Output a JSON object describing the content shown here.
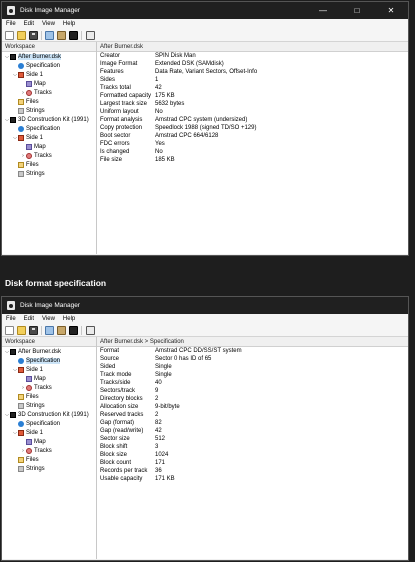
{
  "window1": {
    "title": "Disk Image Manager",
    "menu": [
      "File",
      "Edit",
      "View",
      "Help"
    ],
    "workspace_label": "Workspace",
    "breadcrumb": "After Burner.dsk",
    "tree": [
      {
        "caret": "⌵",
        "icon": "disk",
        "label": "After Burner.dsk",
        "indent": 0,
        "selected": true
      },
      {
        "caret": "",
        "icon": "spec",
        "label": "Specification",
        "indent": 1
      },
      {
        "caret": "⌵",
        "icon": "side",
        "label": "Side 1",
        "indent": 1
      },
      {
        "caret": "",
        "icon": "map",
        "label": "Map",
        "indent": 2
      },
      {
        "caret": "›",
        "icon": "tracks",
        "label": "Tracks",
        "indent": 2
      },
      {
        "caret": "",
        "icon": "files",
        "label": "Files",
        "indent": 1
      },
      {
        "caret": "",
        "icon": "strings",
        "label": "Strings",
        "indent": 1
      },
      {
        "caret": "⌵",
        "icon": "disk",
        "label": "3D Construction Kit (1991)",
        "indent": 0
      },
      {
        "caret": "",
        "icon": "spec",
        "label": "Specification",
        "indent": 1
      },
      {
        "caret": "⌵",
        "icon": "side",
        "label": "Side 1",
        "indent": 1
      },
      {
        "caret": "",
        "icon": "map",
        "label": "Map",
        "indent": 2
      },
      {
        "caret": "›",
        "icon": "tracks",
        "label": "Tracks",
        "indent": 2
      },
      {
        "caret": "",
        "icon": "files",
        "label": "Files",
        "indent": 1
      },
      {
        "caret": "",
        "icon": "strings",
        "label": "Strings",
        "indent": 1
      }
    ],
    "properties": [
      [
        "Creator",
        "SPIN Disk Man"
      ],
      [
        "Image Format",
        "Extended DSK (SAMdisk)"
      ],
      [
        "Features",
        "Data Rate, Variant Sectors, Offset-Info"
      ],
      [
        "Sides",
        "1"
      ],
      [
        "Tracks total",
        "42"
      ],
      [
        "Formatted capacity",
        "175 KB"
      ],
      [
        "Largest track size",
        "5632 bytes"
      ],
      [
        "Uniform layout",
        "No"
      ],
      [
        "Format analysis",
        "Amstrad CPC system (undersized)"
      ],
      [
        "Copy protection",
        "Speedlock 1988 (signed TD/SO +129)"
      ],
      [
        "Boot sector",
        "Amstrad CPC 664/6128"
      ],
      [
        "FDC errors",
        "Yes"
      ],
      [
        "Is changed",
        "No"
      ],
      [
        "File size",
        "185 KB"
      ]
    ]
  },
  "section_heading": "Disk format specification",
  "window2": {
    "title": "Disk Image Manager",
    "menu": [
      "File",
      "Edit",
      "View",
      "Help"
    ],
    "workspace_label": "Workspace",
    "breadcrumb": "After Burner.dsk > Specification",
    "tree": [
      {
        "caret": "⌵",
        "icon": "disk",
        "label": "After Burner.dsk",
        "indent": 0
      },
      {
        "caret": "",
        "icon": "spec",
        "label": "Specification",
        "indent": 1,
        "selected": true
      },
      {
        "caret": "⌵",
        "icon": "side",
        "label": "Side 1",
        "indent": 1
      },
      {
        "caret": "",
        "icon": "map",
        "label": "Map",
        "indent": 2
      },
      {
        "caret": "›",
        "icon": "tracks",
        "label": "Tracks",
        "indent": 2
      },
      {
        "caret": "",
        "icon": "files",
        "label": "Files",
        "indent": 1
      },
      {
        "caret": "",
        "icon": "strings",
        "label": "Strings",
        "indent": 1
      },
      {
        "caret": "⌵",
        "icon": "disk",
        "label": "3D Construction Kit (1991)",
        "indent": 0
      },
      {
        "caret": "",
        "icon": "spec",
        "label": "Specification",
        "indent": 1
      },
      {
        "caret": "⌵",
        "icon": "side",
        "label": "Side 1",
        "indent": 1
      },
      {
        "caret": "",
        "icon": "map",
        "label": "Map",
        "indent": 2
      },
      {
        "caret": "›",
        "icon": "tracks",
        "label": "Tracks",
        "indent": 2
      },
      {
        "caret": "",
        "icon": "files",
        "label": "Files",
        "indent": 1
      },
      {
        "caret": "",
        "icon": "strings",
        "label": "Strings",
        "indent": 1
      }
    ],
    "properties": [
      [
        "Format",
        "Amstrad CPC DD/SS/ST system"
      ],
      [
        "Source",
        "Sector 0 has ID of 65"
      ],
      [
        "Sided",
        "Single"
      ],
      [
        "Track mode",
        "Single"
      ],
      [
        "Tracks/side",
        "40"
      ],
      [
        "Sectors/track",
        "9"
      ],
      [
        "Directory blocks",
        "2"
      ],
      [
        "Allocation size",
        "9-bit/byte"
      ],
      [
        "Reserved tracks",
        "2"
      ],
      [
        "Gap (format)",
        "82"
      ],
      [
        "Gap (read/write)",
        "42"
      ],
      [
        "Sector size",
        "512"
      ],
      [
        "Block shift",
        "3"
      ],
      [
        "Block size",
        "1024"
      ],
      [
        "Block count",
        "171"
      ],
      [
        "Records per track",
        "36"
      ],
      [
        "Usable capacity",
        "171 KB"
      ]
    ]
  }
}
